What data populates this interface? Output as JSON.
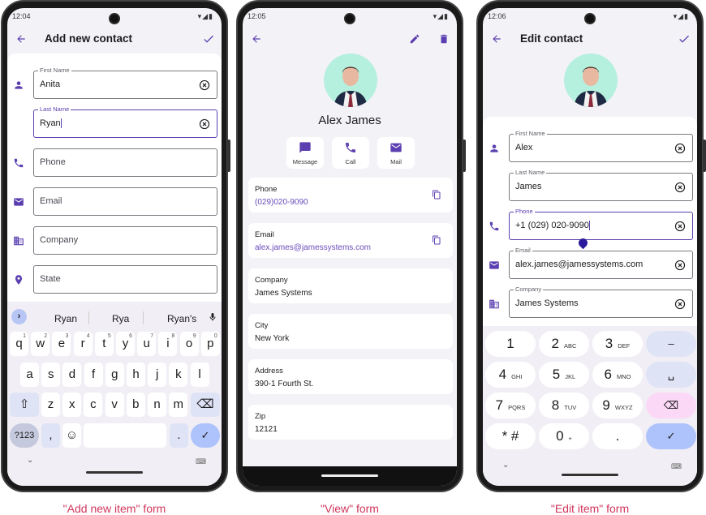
{
  "colors": {
    "accent": "#5b3fb0",
    "caption": "#d0365c",
    "avatar_bg": "#b5f0de"
  },
  "add": {
    "time": "12:04",
    "title": "Add new contact",
    "back_icon": "arrow-left-icon",
    "save_icon": "check-icon",
    "fields": [
      {
        "label": "First Name",
        "value": "Anita",
        "icon": "person-icon"
      },
      {
        "label": "Last Name",
        "value": "Ryan",
        "focused": true
      },
      {
        "placeholder": "Phone",
        "icon": "phone-icon"
      },
      {
        "placeholder": "Email",
        "icon": "mail-icon"
      },
      {
        "placeholder": "Company",
        "icon": "building-icon"
      },
      {
        "placeholder": "State",
        "icon": "location-icon"
      }
    ],
    "suggestions": [
      "Ryan",
      "Rya",
      "Ryan's"
    ],
    "rows": [
      [
        "q",
        "w",
        "e",
        "r",
        "t",
        "y",
        "u",
        "i",
        "o",
        "p"
      ],
      [
        "a",
        "s",
        "d",
        "f",
        "g",
        "h",
        "j",
        "k",
        "l"
      ],
      [
        "z",
        "x",
        "c",
        "v",
        "b",
        "n",
        "m"
      ]
    ],
    "digits": [
      "1",
      "2",
      "3",
      "4",
      "5",
      "6",
      "7",
      "8",
      "9",
      "0"
    ],
    "sym_key": "?123",
    "comma": ",",
    "period": ".",
    "caption": "\"Add new item\" form"
  },
  "view": {
    "time": "12:05",
    "name": "Alex James",
    "actions": [
      {
        "label": "Message",
        "icon": "message-icon"
      },
      {
        "label": "Call",
        "icon": "phone-icon"
      },
      {
        "label": "Mail",
        "icon": "mail-icon"
      }
    ],
    "cards": [
      {
        "title": "Phone",
        "value": "(029)020-9090",
        "link": true,
        "copy": true
      },
      {
        "title": "Email",
        "value": "alex.james@jamessystems.com",
        "link": true,
        "copy": true
      },
      {
        "title": "Company",
        "value": "James Systems"
      },
      {
        "title": "City",
        "value": "New York"
      },
      {
        "title": "Address",
        "value": "390-1 Fourth St."
      },
      {
        "title": "Zip",
        "value": "12121"
      }
    ],
    "caption": "\"View\" form"
  },
  "edit": {
    "time": "12:06",
    "title": "Edit contact",
    "fields": [
      {
        "label": "First Name",
        "value": "Alex",
        "icon": "person-icon"
      },
      {
        "label": "Last Name",
        "value": "James"
      },
      {
        "label": "Phone",
        "value": "+1 (029) 020-9090",
        "icon": "phone-icon",
        "focused": true
      },
      {
        "label": "Email",
        "value": "alex.james@jamessystems.com",
        "icon": "mail-icon"
      },
      {
        "label": "Company",
        "value": "James Systems",
        "icon": "building-icon"
      }
    ],
    "numpad": [
      {
        "d": "1",
        "s": ""
      },
      {
        "d": "2",
        "s": "ABC"
      },
      {
        "d": "3",
        "s": "DEF"
      },
      {
        "d": "–",
        "s": ""
      },
      {
        "d": "4",
        "s": "GHI"
      },
      {
        "d": "5",
        "s": "JKL"
      },
      {
        "d": "6",
        "s": "MNO"
      },
      {
        "d": "␣",
        "s": ""
      },
      {
        "d": "7",
        "s": "PQRS"
      },
      {
        "d": "8",
        "s": "TUV"
      },
      {
        "d": "9",
        "s": "WXYZ"
      },
      {
        "d": "⌫",
        "s": ""
      },
      {
        "d": "* #",
        "s": ""
      },
      {
        "d": "0",
        "s": "+"
      },
      {
        "d": ".",
        "s": ""
      },
      {
        "d": "✓",
        "s": ""
      }
    ],
    "caption": "\"Edit item\" form"
  }
}
